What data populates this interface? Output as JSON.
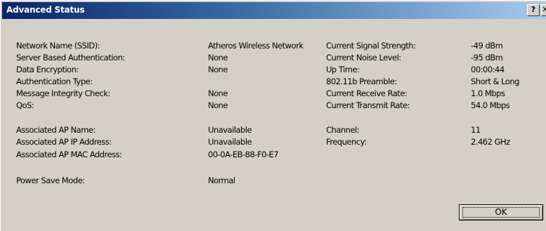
{
  "window": {
    "title": "Advanced Status",
    "help_glyph": "?",
    "close_glyph": "✕"
  },
  "left": [
    {
      "label": "Network Name (SSID):",
      "value": "Atheros Wireless Network"
    },
    {
      "label": "Server Based Authentication:",
      "value": "None"
    },
    {
      "label": "Data Encryption:",
      "value": "None"
    },
    {
      "label": "Authentication Type:",
      "value": ""
    },
    {
      "label": "Message Integrity Check:",
      "value": "None"
    },
    {
      "label": "QoS:",
      "value": "None"
    },
    {
      "label": "Associated AP Name:",
      "value": "Unavailable"
    },
    {
      "label": "Associated AP IP Address:",
      "value": "Unavailable"
    },
    {
      "label": "Associated AP MAC Address:",
      "value": "00-0A-EB-88-F0-E7"
    },
    {
      "label": "Power Save Mode:",
      "value": "Normal"
    }
  ],
  "right": [
    {
      "label": "Current Signal Strength:",
      "value": "-49 dBm"
    },
    {
      "label": "Current Noise Level:",
      "value": "-95 dBm"
    },
    {
      "label": "Up Time:",
      "value": "00:00:44"
    },
    {
      "label": "802.11b Preamble:",
      "value": "Short & Long"
    },
    {
      "label": "Current Receive Rate:",
      "value": "1.0 Mbps"
    },
    {
      "label": "Current Transmit Rate:",
      "value": "54.0 Mbps"
    },
    {
      "label": "Channel:",
      "value": "11"
    },
    {
      "label": "Frequency:",
      "value": "2.462 GHz"
    }
  ],
  "ok_button": {
    "label": "OK"
  }
}
